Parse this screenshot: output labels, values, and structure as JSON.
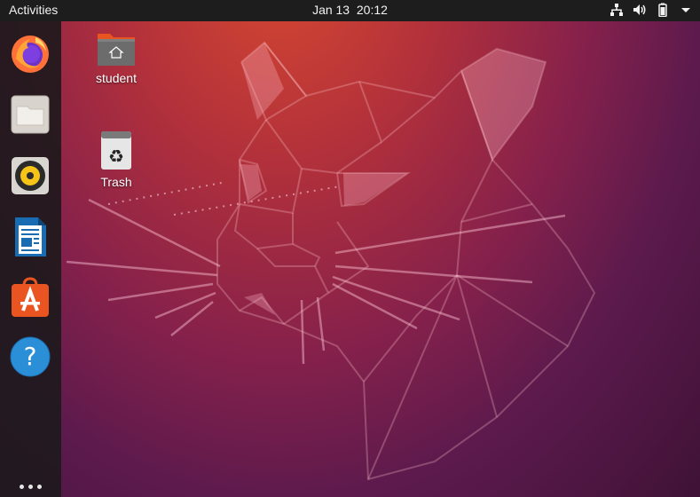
{
  "topbar": {
    "activities_label": "Activities",
    "clock_text": "Jan 13  20:12",
    "tray_icons": [
      "network-icon",
      "volume-icon",
      "battery-icon",
      "system-menu-arrow-icon"
    ]
  },
  "dock": {
    "items": [
      {
        "name": "firefox",
        "icon": "firefox-icon"
      },
      {
        "name": "files",
        "icon": "files-icon"
      },
      {
        "name": "rhythmbox",
        "icon": "rhythmbox-icon"
      },
      {
        "name": "libreoffice-writer",
        "icon": "writer-icon"
      },
      {
        "name": "software",
        "icon": "software-icon"
      },
      {
        "name": "help",
        "icon": "help-icon"
      }
    ],
    "show_apps_icon": "show-applications-icon"
  },
  "desktop": {
    "icons": [
      {
        "label": "student",
        "icon": "home-folder-icon"
      },
      {
        "label": "Trash",
        "icon": "trash-icon"
      }
    ]
  },
  "colors": {
    "topbar_bg": "#1d1d1d",
    "dock_bg": "#1e191c",
    "wallpaper_top": "#d8492f",
    "wallpaper_bottom": "#3f1236"
  }
}
